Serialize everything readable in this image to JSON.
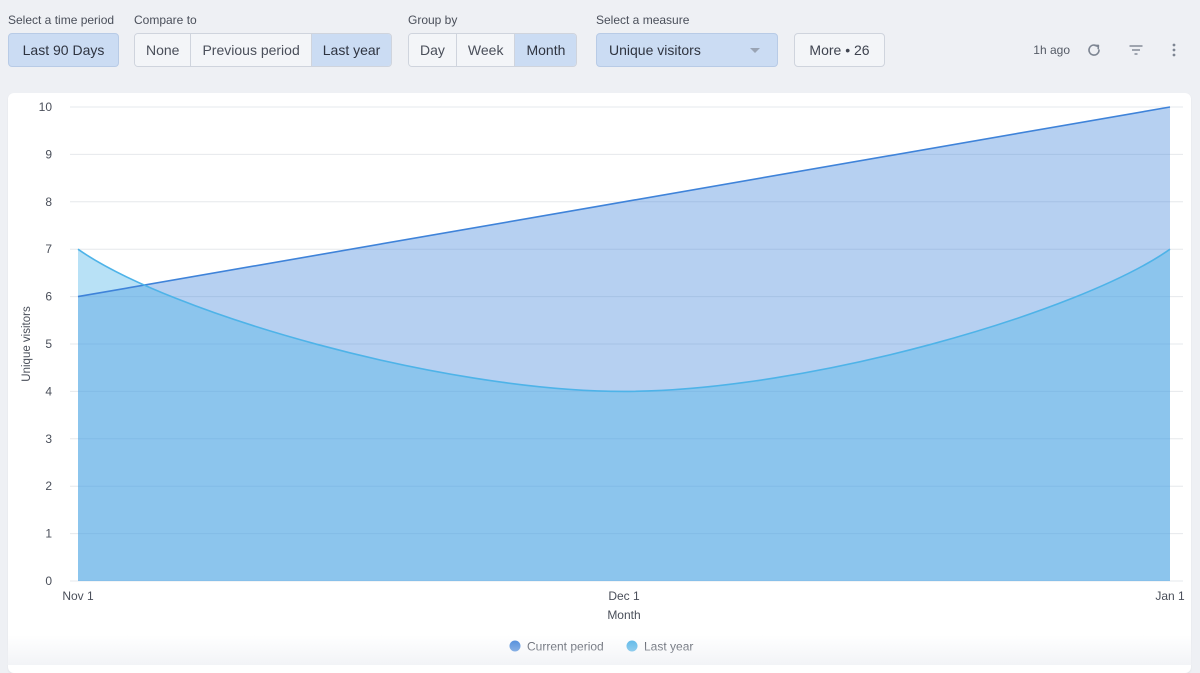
{
  "toolbar": {
    "time_period": {
      "label": "Select a time period",
      "value": "Last 90 Days"
    },
    "compare_to": {
      "label": "Compare to",
      "options": [
        "None",
        "Previous period",
        "Last year"
      ],
      "selected": "Last year"
    },
    "group_by": {
      "label": "Group by",
      "options": [
        "Day",
        "Week",
        "Month"
      ],
      "selected": "Month"
    },
    "measure": {
      "label": "Select a measure",
      "value": "Unique visitors"
    },
    "more_button": "More • 26",
    "updated": "1h ago",
    "icons": [
      "refresh-icon",
      "filter-icon",
      "more-vertical-icon"
    ]
  },
  "colors": {
    "current_period": "#3f83d9",
    "last_year": "#4eb3e8",
    "accent": "#cbdcf3"
  },
  "chart_data": {
    "type": "area",
    "title": "",
    "xlabel": "Month",
    "ylabel": "Unique visitors",
    "x": [
      "Nov 1",
      "Dec 1",
      "Jan 1"
    ],
    "ylim": [
      0,
      10
    ],
    "yticks": [
      0,
      1,
      2,
      3,
      4,
      5,
      6,
      7,
      8,
      9,
      10
    ],
    "grid": true,
    "legend_position": "bottom-center",
    "series": [
      {
        "name": "Current period",
        "values": [
          6,
          8,
          10
        ],
        "color": "#3f83d9",
        "curve": "linear"
      },
      {
        "name": "Last year",
        "values": [
          7,
          4,
          7
        ],
        "color": "#4eb3e8",
        "curve": "smooth"
      }
    ]
  }
}
